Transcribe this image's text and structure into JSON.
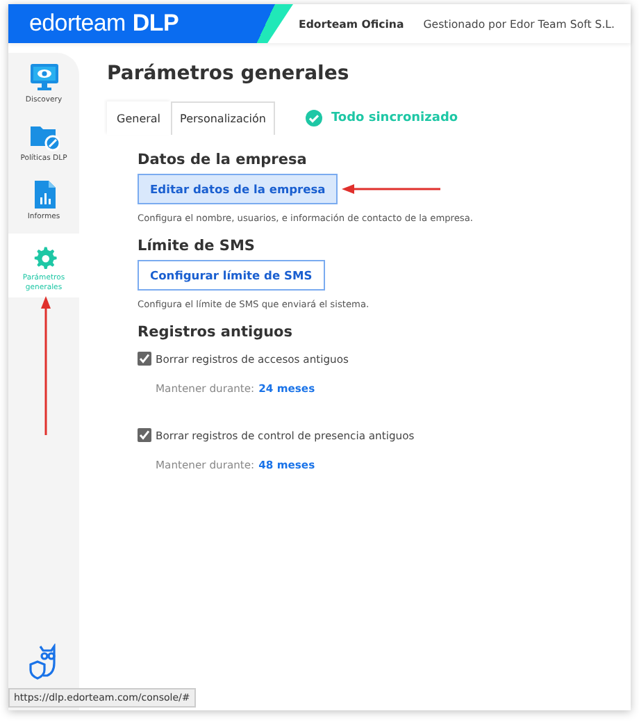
{
  "header": {
    "logo_light": "edorteam",
    "logo_bold": "DLP",
    "org": "Edorteam Oficina",
    "managed_by": "Gestionado por Edor Team Soft S.L."
  },
  "sidebar": {
    "items": [
      {
        "label": "Discovery",
        "selected": false
      },
      {
        "label": "Políticas DLP",
        "selected": false
      },
      {
        "label": "Informes",
        "selected": false
      },
      {
        "label": "Parámetros generales",
        "selected": true
      }
    ]
  },
  "page": {
    "title": "Parámetros generales",
    "tabs": [
      {
        "label": "General",
        "selected": true
      },
      {
        "label": "Personalización",
        "selected": false
      }
    ],
    "sync_status": "Todo sincronizado",
    "sections": [
      {
        "heading": "Datos de la empresa",
        "button": "Editar datos de la empresa",
        "highlighted": true,
        "annotated": true,
        "description": "Configura el nombre, usuarios, e información de contacto de la empresa."
      },
      {
        "heading": "Límite de SMS",
        "button": "Configurar límite de SMS",
        "highlighted": false,
        "annotated": false,
        "description": "Configura el límite de SMS que enviará el sistema."
      }
    ],
    "logs": {
      "heading": "Registros antiguos",
      "items": [
        {
          "label": "Borrar registros de accesos antiguos",
          "checked": true,
          "keep_label": "Mantener durante:",
          "keep_value": "24 meses"
        },
        {
          "label": "Borrar registros de control de presencia antiguos",
          "checked": true,
          "keep_label": "Mantener durante:",
          "keep_value": "48 meses"
        }
      ]
    }
  },
  "status_url": "https://dlp.edorteam.com/console/#"
}
